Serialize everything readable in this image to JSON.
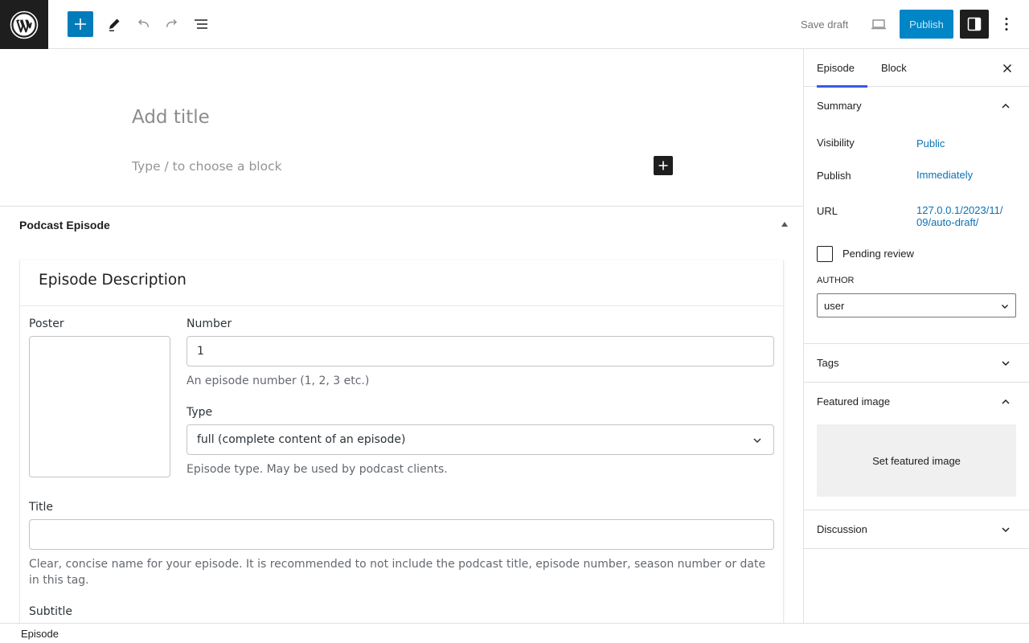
{
  "toolbar": {
    "logo_icon": "wordpress-logo-icon",
    "add_block_icon": "plus-icon",
    "tools_icon": "pencil-icon",
    "undo_icon": "undo-icon",
    "redo_icon": "redo-icon",
    "document_overview_icon": "list-view-icon",
    "save_draft_label": "Save draft",
    "preview_icon": "laptop-icon",
    "publish_label": "Publish",
    "settings_icon": "sidebar-icon",
    "options_icon": "more-vertical-icon",
    "accent_color": "#007cba"
  },
  "editor": {
    "title_placeholder": "Add title",
    "block_placeholder": "Type / to choose a block"
  },
  "metabox": {
    "title": "Podcast Episode",
    "panel_title": "Episode Description",
    "poster_label": "Poster",
    "number_label": "Number",
    "number_value": "1",
    "number_help": "An episode number (1, 2, 3 etc.)",
    "type_label": "Type",
    "type_value": "full (complete content of an episode)",
    "type_help": "Episode type. May be used by podcast clients.",
    "title_label": "Title",
    "title_value": "",
    "title_help": "Clear, concise name for your episode. It is recommended to not include the podcast title, episode number, season number or date in this tag.",
    "subtitle_label": "Subtitle"
  },
  "footer": {
    "breadcrumb": "Episode"
  },
  "sidebar": {
    "tabs": [
      {
        "label": "Episode",
        "active": true
      },
      {
        "label": "Block",
        "active": false
      }
    ],
    "summary": {
      "label": "Summary",
      "visibility_label": "Visibility",
      "visibility_value": "Public",
      "publish_label": "Publish",
      "publish_value": "Immediately",
      "url_label": "URL",
      "url_value_line1": "127.0.0.1/2023/11/",
      "url_value_line2": "09/auto-draft/",
      "pending_label": "Pending review",
      "pending_checked": false,
      "author_label": "AUTHOR",
      "author_value": "user"
    },
    "tags_label": "Tags",
    "featured_image_label": "Featured image",
    "set_featured_image": "Set featured image",
    "discussion_label": "Discussion",
    "link_color": "#0a72b4",
    "active_tab_color": "#3858e9"
  }
}
